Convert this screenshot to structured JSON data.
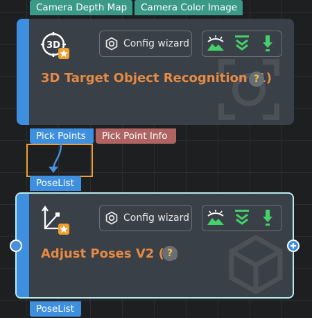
{
  "node1": {
    "input_ports": [
      "Camera Depth Map",
      "Camera Color Image"
    ],
    "output_ports": [
      "Pick Points",
      "Pick Point Info"
    ],
    "icon": "3d-recognition-icon",
    "icon_text": "3D",
    "config_label": "Config wizard",
    "title": "3D Target Object Recognition (1)",
    "help": "?",
    "toolbar_icons": [
      "visualize-icon",
      "double-chevron-down-icon",
      "download-arrow-icon"
    ]
  },
  "node2": {
    "input_ports": [
      "PoseList"
    ],
    "output_ports": [
      "PoseList"
    ],
    "icon": "adjust-poses-icon",
    "config_label": "Config wizard",
    "title": "Adjust Poses V2 (1)",
    "help": "?",
    "toolbar_icons": [
      "visualize-icon",
      "double-chevron-down-icon",
      "download-arrow-icon"
    ],
    "right_port_icon": "plus-icon"
  },
  "colors": {
    "background": "#1e1f21",
    "node": "#3a4047",
    "accent_blue": "#3f8fe0",
    "title_orange": "#e68a44",
    "port_teal": "#3b9a87",
    "port_red": "#b06462",
    "selection_highlight": "#f0a030",
    "selected_border": "#b8ecec",
    "toolbar_green": "#44d06a"
  }
}
